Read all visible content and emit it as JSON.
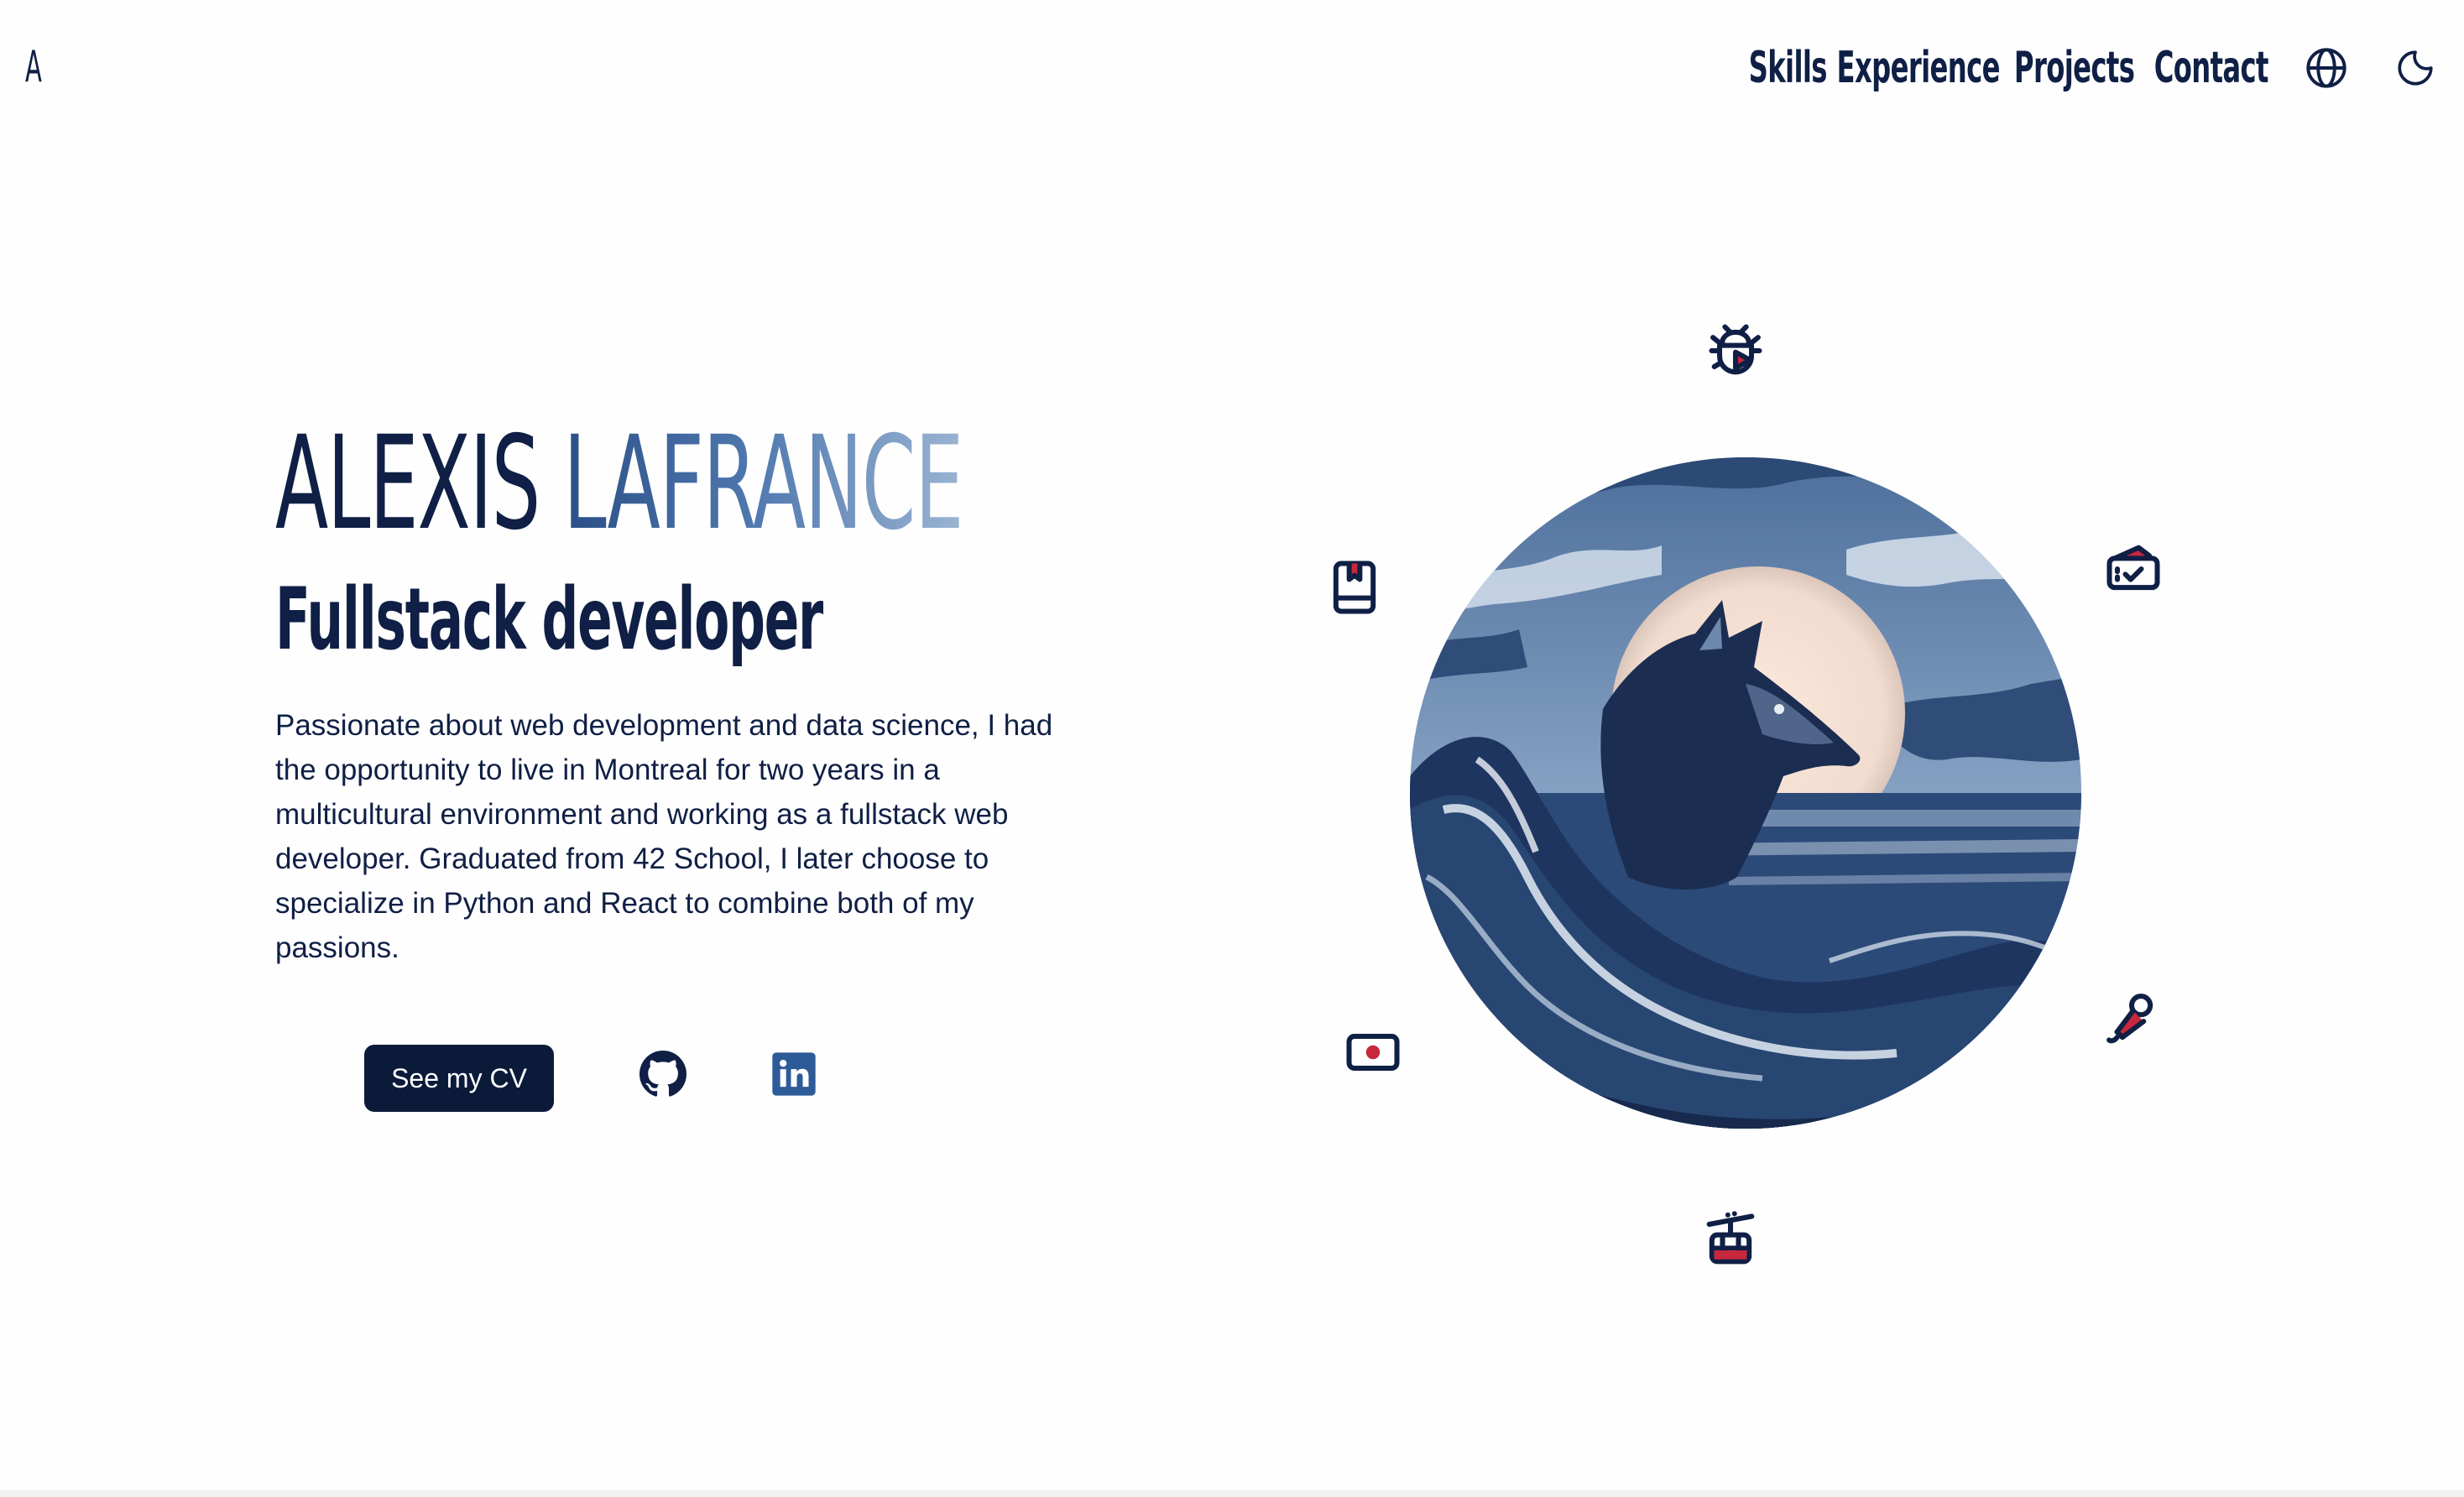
{
  "logo": "A",
  "nav": {
    "links": [
      "Skills",
      "Experience",
      "Projects",
      "Contact"
    ],
    "icons": [
      "globe-icon",
      "moon-icon"
    ]
  },
  "hero": {
    "first_name": "ALEXIS",
    "last_name": "LAFRANCE",
    "role": "Fullstack developer",
    "description": "Passionate about web development and data science, I had the opportunity to live in Montreal for two years in a multicultural environment and working as a fullstack web developer. Graduated from 42 School, I later choose to specialize in Python and React to combine both of my passions.",
    "cv_button": "See my CV",
    "social": [
      "github-icon",
      "linkedin-icon"
    ]
  },
  "illustration": {
    "image": "wolf-in-waves",
    "orbit_icons": [
      "bug-play-icon",
      "ticket-icon",
      "microphone-icon",
      "cable-car-icon",
      "camera-record-icon",
      "bookmark-book-icon"
    ]
  },
  "colors": {
    "navy": "#0f1f45",
    "accent_red": "#c8283c",
    "gradient_start": "#2b4f86",
    "gradient_end": "#9ab4d2"
  }
}
